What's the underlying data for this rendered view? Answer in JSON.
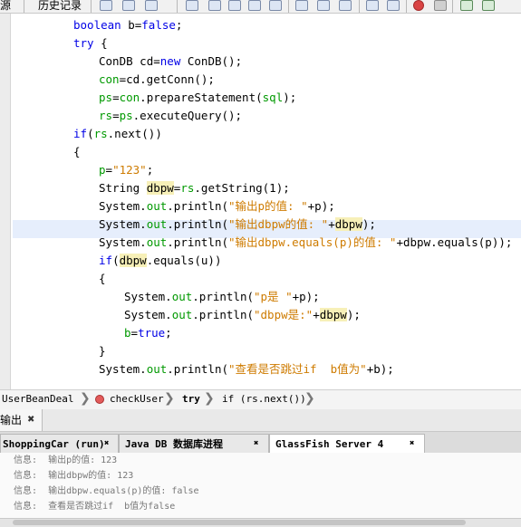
{
  "toolbar": {
    "source_tab": "源",
    "history_tab": "历史记录"
  },
  "code": {
    "l1": [
      "boolean",
      "b",
      "false"
    ],
    "l2": [
      "try",
      "{"
    ],
    "l3": [
      "ConDB",
      "cd",
      "new",
      "ConDB()"
    ],
    "l4": [
      "con",
      "cd.getConn();"
    ],
    "l5": [
      "ps",
      "con",
      ".prepareStatement(",
      "sql",
      ");"
    ],
    "l6": [
      "rs",
      "ps",
      ".executeQuery();"
    ],
    "l7": [
      "if",
      "rs",
      ".next())"
    ],
    "l8": "{",
    "l9": [
      "p",
      "\"123\""
    ],
    "l10": [
      "String",
      "dbpw",
      "rs",
      ".getString(1);"
    ],
    "l11": [
      "System.",
      "out",
      ".println(",
      "\"输出p的值: \"",
      "+p);"
    ],
    "l12": [
      "System.",
      "out",
      ".println(",
      "\"输出dbpw的值: \"",
      "+",
      "dbpw",
      ");"
    ],
    "l13": [
      "System.",
      "out",
      ".println(",
      "\"输出dbpw.equals(p)的值: \"",
      "+dbpw.equals(p));"
    ],
    "l14": [
      "if",
      "dbpw",
      ".equals(u))"
    ],
    "l15": "{",
    "l16": [
      "System.",
      "out",
      ".println(",
      "\"p是 \"",
      "+p);"
    ],
    "l17": [
      "System.",
      "out",
      ".println(",
      "\"dbpw是:\"",
      "+",
      "dbpw",
      ");"
    ],
    "l18": [
      "b",
      "true"
    ],
    "l19": "}",
    "l20": [
      "System.",
      "out",
      ".println(",
      "\"查看是否跳过if  b值为\"",
      "+b);"
    ]
  },
  "breadcrumb": [
    "UserBeanDeal",
    "checkUser",
    "try",
    "if (rs.next())"
  ],
  "output": {
    "title": "输出",
    "tabs": [
      "ShoppingCar (run)",
      "Java DB 数据库进程",
      "GlassFish Server 4"
    ],
    "lines": [
      [
        "信息:",
        "输出p的值: 123"
      ],
      [
        "信息:",
        "输出dbpw的值: 123"
      ],
      [
        "信息:",
        "输出dbpw.equals(p)的值: false"
      ],
      [
        "信息:",
        "查看是否跳过if  b值为false"
      ]
    ]
  }
}
